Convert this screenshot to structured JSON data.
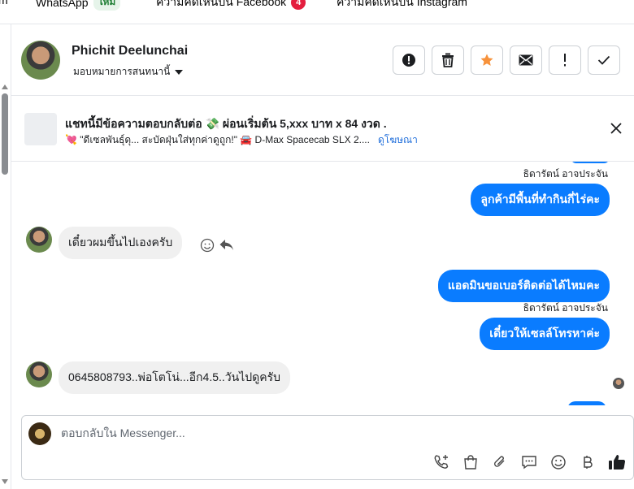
{
  "tabs": [
    {
      "label": "m"
    },
    {
      "label": "WhatsApp",
      "badge": "ใหม่"
    },
    {
      "label": "ความคิดเห็นบน Facebook",
      "badge": "4"
    },
    {
      "label": "ความคิดเห็นบน Instagram"
    }
  ],
  "header": {
    "name": "Phichit Deelunchai",
    "assign_label": "มอบหมายการสนทนานี้"
  },
  "ad": {
    "title": "แชทนี้มีข้อความตอบกลับต่อ 💸 ผ่อนเริ่มต้น 5,xxx บาท x 84 งวด .",
    "sub_text": "💘 \"ดีเซลพันธุ์ดุ... สะบัดฝุ่นใส่ทุกค่าดูถูก!\" 🚘 D-Max Spacecab SLX 2....",
    "link": "ดูโฆษณา"
  },
  "messages": {
    "sender_1": "ธิดารัตน์ อาจประจัน",
    "out_1": "ลูกค้ามีพื้นที่ทำกินกี่ไร่คะ",
    "in_1": "เดี๋ยวผมขึ้นไปเองครับ",
    "out_2": "แอดมินขอเบอร์ติดต่อได้ไหมคะ",
    "sender_2": "ธิดารัตน์ อาจประจัน",
    "out_3": "เดี๋ยวให้เซลล์โทรหาค่ะ",
    "in_2": "0645808793..พ่อโตโน่...อีก4.5..วันไปดูครับ"
  },
  "composer": {
    "placeholder": "ตอบกลับใน Messenger..."
  },
  "colors": {
    "accent": "#0a7cff",
    "incoming": "#f0f0f0",
    "star": "#f7923b"
  }
}
